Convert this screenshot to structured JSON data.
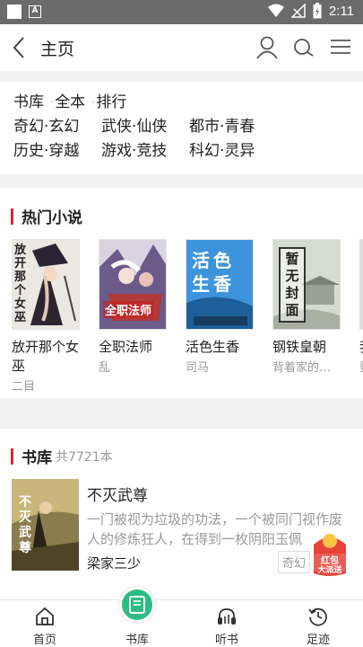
{
  "status_bar": {
    "time": "2:11",
    "notif_letter": "A"
  },
  "header": {
    "title": "主页"
  },
  "categories": {
    "row1": [
      "书库",
      "全本",
      "排行"
    ],
    "grid": [
      [
        "奇幻·玄幻",
        "武侠·仙侠",
        "都市·青春"
      ],
      [
        "历史·穿越",
        "游戏·竞技",
        "科幻·灵异"
      ]
    ]
  },
  "hot": {
    "title": "热门小说",
    "books": [
      {
        "name": "放开那个女巫",
        "author": "二目",
        "cover_text": "放开那个女巫",
        "cover_color": "#e9e6e2"
      },
      {
        "name": "全职法师",
        "author": "乱",
        "cover_text": "全职法师",
        "cover_color": "#3a3245"
      },
      {
        "name": "活色生香",
        "author": "司马",
        "cover_text": "活色生香",
        "cover_color": "#3b8fd6"
      },
      {
        "name": "钢铁皇朝",
        "author": "背着家的…",
        "cover_text": "暂无封面",
        "cover_color": "#c9cfc4"
      },
      {
        "name": "我的",
        "author": "要",
        "cover_text": "",
        "cover_color": "#dddddd"
      }
    ]
  },
  "library": {
    "title": "书库",
    "count": "共7721本",
    "book": {
      "title": "不灭武尊",
      "description": "一门被视为垃圾的功法，一个被同门视作废人的修炼狂人，在得到一枚阴阳玉佩",
      "author": "梁家三少",
      "tag": "奇幻",
      "cover_text": "不灭武尊"
    },
    "red_packet": [
      "红包",
      "大派送"
    ]
  },
  "tabbar": {
    "tabs": [
      {
        "label": "首页",
        "icon": "home-icon"
      },
      {
        "label": "书库",
        "icon": "book-icon"
      },
      {
        "label": "听书",
        "icon": "headphones-icon"
      },
      {
        "label": "足迹",
        "icon": "history-icon"
      }
    ],
    "active_color": "#2dbd84"
  },
  "colors": {
    "accent": "#d8292f",
    "active_tab": "#2dbd84"
  }
}
